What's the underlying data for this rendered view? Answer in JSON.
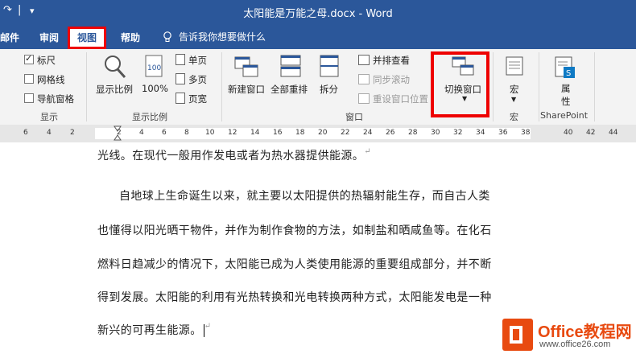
{
  "window": {
    "title": "太阳能是万能之母.docx  -  Word"
  },
  "quick_access": {
    "redo_icon": "redo-icon",
    "customize_icon": "chevron-down-icon"
  },
  "tabs": [
    {
      "label": "邮件"
    },
    {
      "label": "审阅"
    },
    {
      "label": "视图",
      "active": true
    },
    {
      "label": "帮助"
    }
  ],
  "tell_me": {
    "label": "告诉我你想要做什么"
  },
  "ribbon": {
    "show": {
      "ruler": "标尺",
      "gridlines": "网格线",
      "nav_pane": "导航窗格",
      "group": "显示",
      "ruler_checked": true,
      "gridlines_checked": false,
      "nav_pane_checked": false
    },
    "zoom": {
      "zoom_btn": "显示比例",
      "hundred": "100%",
      "one_page": "单页",
      "multi_page": "多页",
      "page_width": "页宽",
      "group": "显示比例"
    },
    "window": {
      "new_window": "新建窗口",
      "arrange_all": "全部重排",
      "split": "拆分",
      "side_by_side": "并排查看",
      "sync_scroll": "同步滚动",
      "reset_pos": "重设窗口位置",
      "switch_windows": "切换窗口",
      "group": "窗口"
    },
    "macros": {
      "label": "宏",
      "group": "宏"
    },
    "properties": {
      "label1": "属",
      "label2": "性",
      "group": "SharePoint"
    }
  },
  "ruler": {
    "left_numbers": [
      "6",
      "4",
      "2"
    ],
    "right_numbers": [
      "2",
      "4",
      "6",
      "8",
      "10",
      "12",
      "14",
      "16",
      "18",
      "20",
      "22",
      "24",
      "26",
      "28",
      "30",
      "32",
      "34",
      "36",
      "38",
      "40",
      "42",
      "44"
    ]
  },
  "document": {
    "lines": [
      "光线。在现代一般用作发电或者为热水器提供能源。",
      "自地球上生命诞生以来，就主要以太阳提供的热辐射能生存，而自古人类",
      "也懂得以阳光晒干物件，并作为制作食物的方法，如制盐和晒咸鱼等。在化石",
      "燃料日趋减少的情况下，太阳能已成为人类使用能源的重要组成部分，并不断",
      "得到发展。太阳能的利用有光热转换和光电转换两种方式，太阳能发电是一种",
      "新兴的可再生能源。"
    ]
  },
  "watermark": {
    "brand": "Office教程网",
    "url": "www.office26.com"
  },
  "colors": {
    "ribbon_blue": "#2b579a",
    "highlight_red": "#e00000"
  }
}
